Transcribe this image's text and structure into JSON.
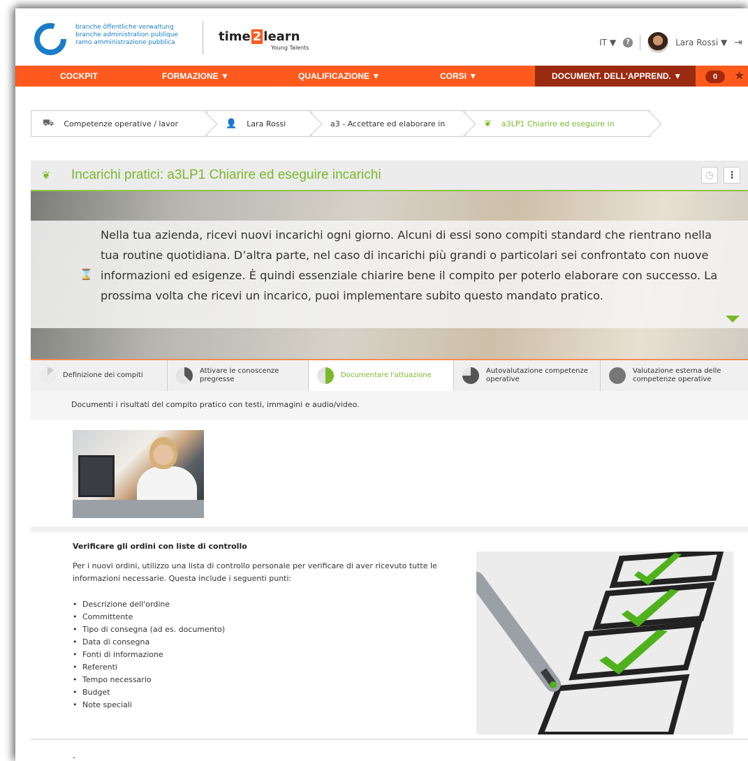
{
  "header": {
    "org_lines": [
      "branche öffentliche verwaltung",
      "branche administration publique",
      "ramo amministrazione pubblica"
    ],
    "brand_left": "time",
    "brand_two": "2",
    "brand_right": "learn",
    "brand_sub": "Young Talents",
    "language": "IT",
    "user_name": "Lara Rossi",
    "icons": [
      "help-icon",
      "avatar",
      "logout-icon"
    ]
  },
  "nav": {
    "items": [
      "COCKPIT",
      "FORMAZIONE ▼",
      "QUALIFICAZIONE ▼",
      "CORSI ▼",
      "DOCUMENT. DELL'APPREND. ▼"
    ],
    "badge": "0",
    "colors": {
      "bar": "#ff5a1e",
      "active": "#9b2b10"
    }
  },
  "breadcrumb": [
    {
      "icon": "competences-icon",
      "label": "Competenze operative / lavor"
    },
    {
      "icon": "user-icon",
      "label": "Lara Rossi"
    },
    {
      "icon": "",
      "label": "a3 - Accettare ed elaborare in"
    },
    {
      "icon": "practical-task-icon",
      "label": "a3LP1 Chiarire ed eseguire in"
    }
  ],
  "task": {
    "title": "Incarichi pratici: a3LP1 Chiarire ed eseguire incarichi",
    "description": "Nella tua azienda, ricevi nuovi incarichi ogni giorno. Alcuni di essi sono compiti standard che rientrano nella tua routine quotidiana. D’altra parte, nel caso di incarichi più grandi o particolari sei confrontato con nuove informazioni ed esigenze. È quindi essenziale chiarire bene il compito per poterlo elaborare con successo. La prossima volta che ricevi un incarico, puoi implementare subito questo mandato pratico."
  },
  "tabs": [
    {
      "label": "Definizione dei compiti",
      "progress": 0.125
    },
    {
      "label": "Attivare le conoscenze pregresse",
      "progress": 0.375
    },
    {
      "label": "Documentare l'attuazione",
      "progress": 0.5,
      "active": true
    },
    {
      "label": "Autovalutazione competenze operative",
      "progress": 0.75
    },
    {
      "label": "Valutazione esterna delle competenze operative",
      "progress": 1.0
    }
  ],
  "section_note": "Documenti i risultati del compito pratico con testi, immagini e audio/video.",
  "entry": {
    "title": "Verificare gli ordini con liste di controllo",
    "intro": "Per i nuovi ordini, utilizzo una lista di controllo personale per verificare di aver ricevuto tutte le informazioni necessarie. Questa include i seguenti punti:",
    "items": [
      "Descrizione dell'ordine",
      "Committente",
      "Tipo di consegna (ad es. documento)",
      "Data di consegna",
      "Fonti di informazione",
      "Referenti",
      "Tempo necessario",
      "Budget",
      "Note speciali"
    ]
  },
  "trailing": "-"
}
